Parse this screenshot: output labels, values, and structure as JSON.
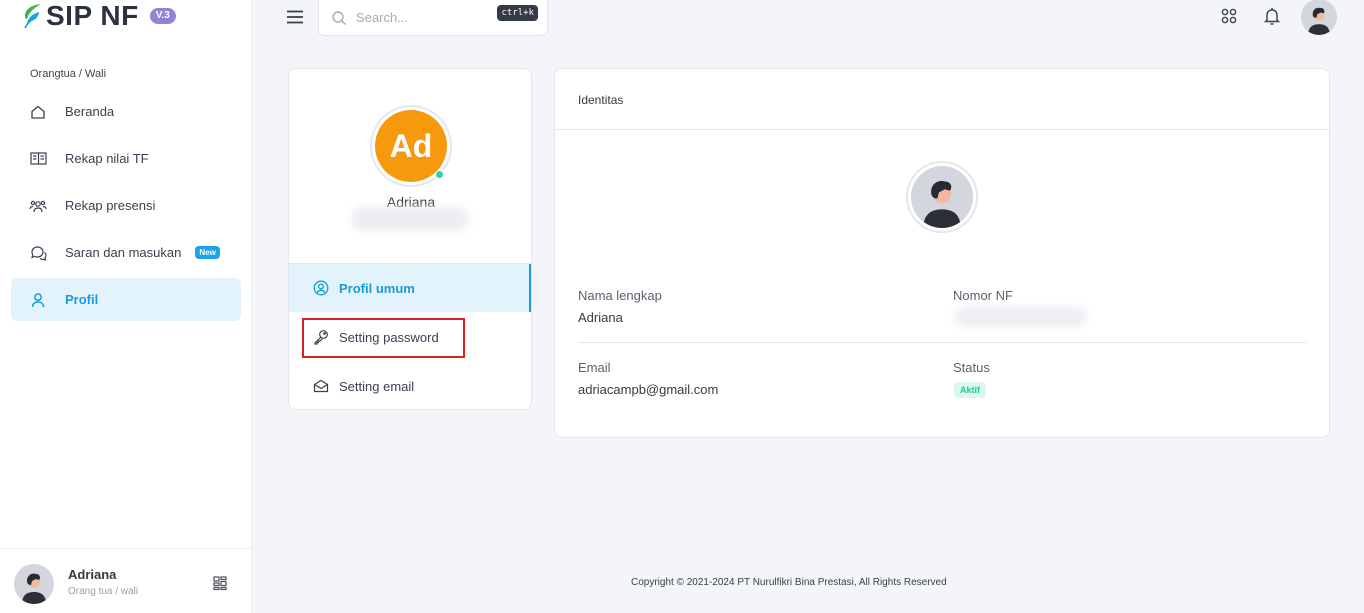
{
  "app": {
    "name": "SIP NF",
    "version": "V.3",
    "brand_green": "#3bb54a",
    "accent": "#1a9bd7"
  },
  "sidebar": {
    "section_label": "Orangtua / Wali",
    "items": [
      {
        "label": "Beranda",
        "icon": "home-icon"
      },
      {
        "label": "Rekap nilai TF",
        "icon": "book-icon"
      },
      {
        "label": "Rekap presensi",
        "icon": "users-icon"
      },
      {
        "label": "Saran dan masukan",
        "icon": "chat-icon",
        "badge": "New"
      },
      {
        "label": "Profil",
        "icon": "user-icon",
        "active": true
      }
    ],
    "user": {
      "name": "Adriana",
      "role": "Orang tua / wali"
    }
  },
  "topbar": {
    "search_placeholder": "Search...",
    "shortcut": "ctrl+k"
  },
  "profile_card": {
    "initials": "Ad",
    "name": "Adriana",
    "tabs": [
      {
        "label": "Profil umum",
        "icon": "user-circle-icon",
        "active": true
      },
      {
        "label": "Setting password",
        "icon": "key-icon"
      },
      {
        "label": "Setting email",
        "icon": "envelope-icon"
      }
    ]
  },
  "identity": {
    "title": "Identitas",
    "full_name_label": "Nama lengkap",
    "full_name": "Adriana",
    "nf_label": "Nomor NF",
    "email_label": "Email",
    "email": "adriacampb@gmail.com",
    "status_label": "Status",
    "status": "Aktif"
  },
  "footer": {
    "copyright": "Copyright © 2021-2024 PT Nurulfikri Bina Prestasi, All Rights Reserved"
  }
}
